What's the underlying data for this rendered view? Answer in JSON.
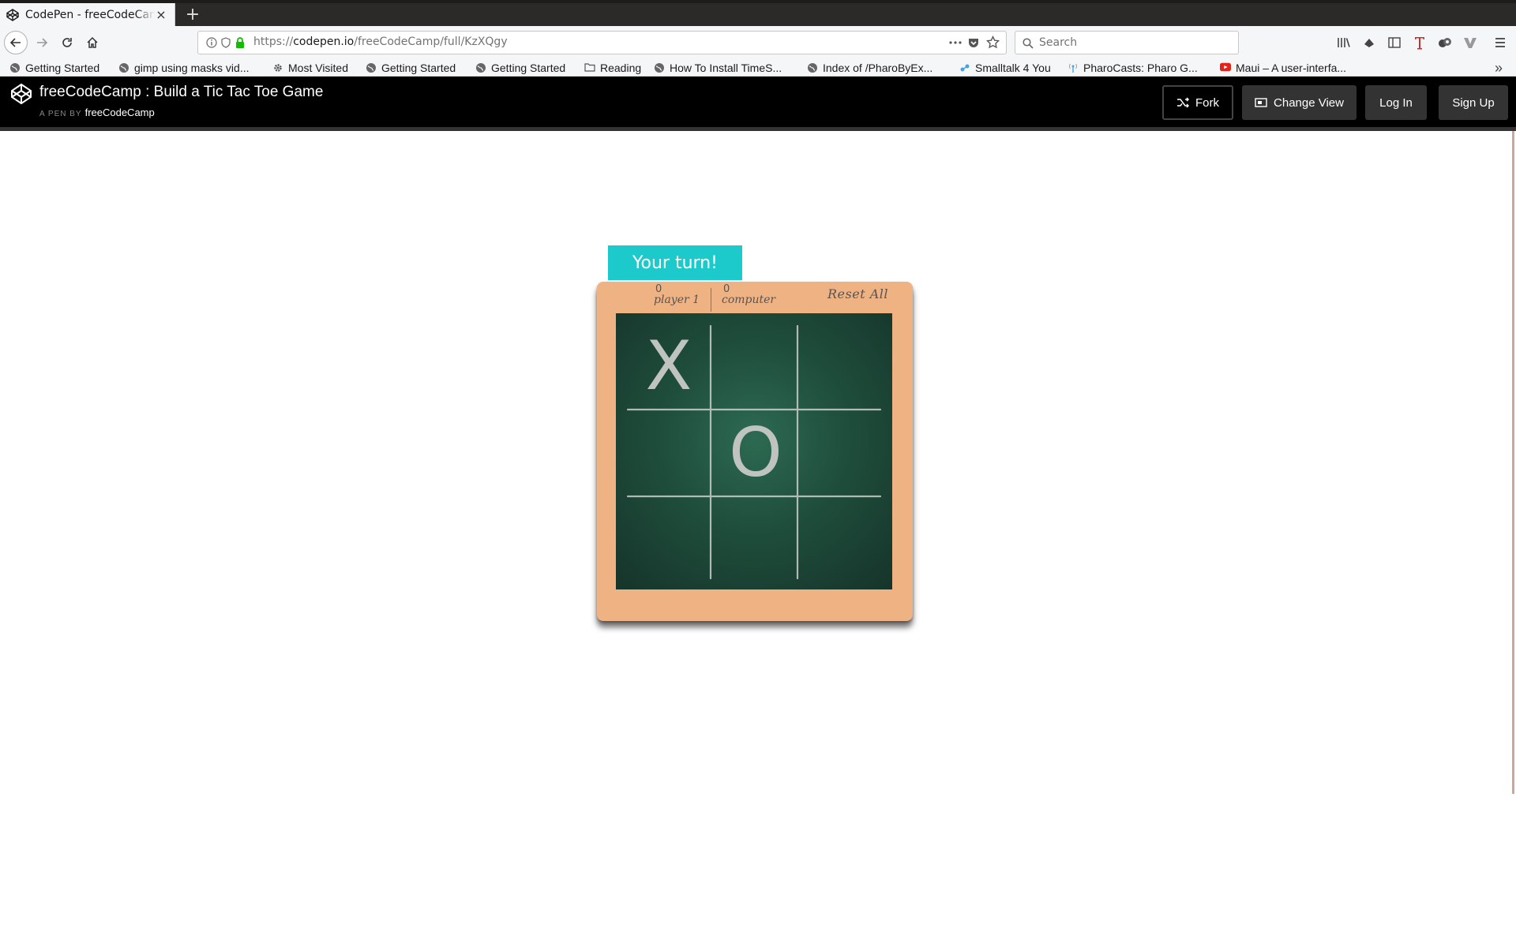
{
  "browser": {
    "tab_title": "CodePen - freeCodeCamp : Build a Tic Tac Toe Game",
    "tab_close": "×",
    "new_tab": "+",
    "url_prefix": "https://",
    "url_host": "codepen.io",
    "url_path": "/freeCodeCamp/full/KzXQgy",
    "search_placeholder": "Search",
    "bookmarks": [
      "Getting Started",
      "gimp using masks vid...",
      "Most Visited",
      "Getting Started",
      "Getting Started",
      "Reading",
      "How To Install TimeS...",
      "Index of /PharoByEx...",
      "Smalltalk 4 You",
      "PharoCasts: Pharo G...",
      "Maui – A user-interfa..."
    ],
    "overflow": "»"
  },
  "codepen": {
    "title": "freeCodeCamp : Build a Tic Tac Toe Game",
    "byline_prefix": "A PEN BY",
    "author": "freeCodeCamp",
    "buttons": {
      "fork": "Fork",
      "change_view": "Change View",
      "login": "Log In",
      "signup": "Sign Up"
    }
  },
  "game": {
    "status": "Your turn!",
    "player_score": "0",
    "player_label": "player 1",
    "computer_score": "0",
    "computer_label": "computer",
    "reset": "Reset All",
    "board": [
      "X",
      "",
      "",
      "",
      "O",
      "",
      "",
      "",
      ""
    ]
  },
  "colors": {
    "banner": "#1ccacb",
    "frame": "#efb283",
    "chalkboard": "#1f4e3c",
    "chalk": "#bfc4c1"
  }
}
